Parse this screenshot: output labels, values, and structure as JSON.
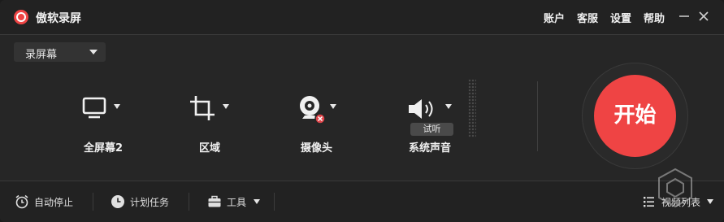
{
  "app": {
    "title": "傲软录屏"
  },
  "topnav": {
    "account": "账户",
    "service": "客服",
    "settings": "设置",
    "help": "帮助"
  },
  "mode": {
    "selected": "录屏幕"
  },
  "sources": {
    "fullscreen": "全屏幕2",
    "region": "区域",
    "webcam": "摄像头",
    "system_audio": "系统声音",
    "test_listen": "试听"
  },
  "start": {
    "label": "开始"
  },
  "bottom": {
    "auto_stop": "自动停止",
    "schedule": "计划任务",
    "tools": "工具",
    "video_list": "视频列表"
  },
  "colors": {
    "accent": "#ef4444",
    "background": "#262626"
  }
}
